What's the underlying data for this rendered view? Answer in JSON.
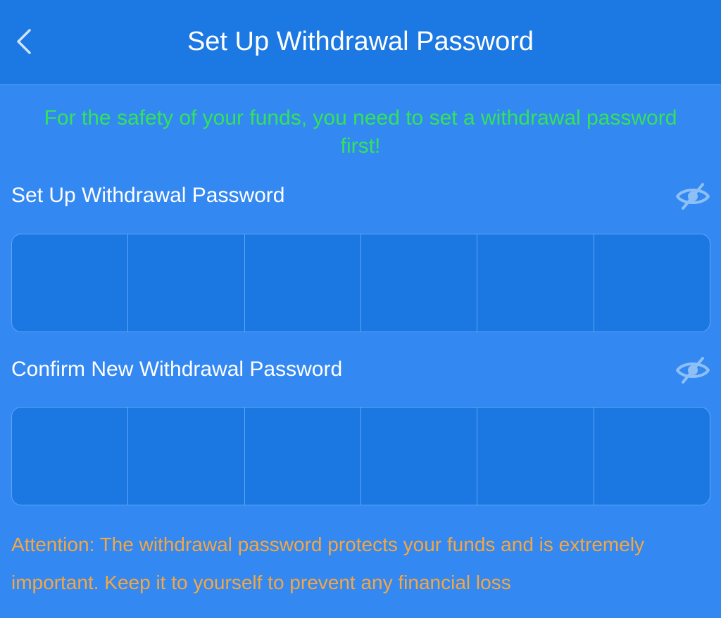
{
  "header": {
    "title": "Set Up Withdrawal Password",
    "back_icon": "chevron-left-icon"
  },
  "notice": "For the safety of your funds, you need to set a withdrawal password first!",
  "fields": [
    {
      "label": "Set Up Withdrawal Password",
      "toggle_icon": "eye-off-icon",
      "digits": [
        "",
        "",
        "",
        "",
        "",
        ""
      ]
    },
    {
      "label": "Confirm New Withdrawal Password",
      "toggle_icon": "eye-off-icon",
      "digits": [
        "",
        "",
        "",
        "",
        "",
        ""
      ]
    }
  ],
  "attention": "Attention: The withdrawal password protects your funds and is extremely important. Keep it to yourself to prevent any financial loss",
  "colors": {
    "background": "#3388f2",
    "header": "#1c78e2",
    "notice": "#33e35a",
    "attention": "#f5a741",
    "pin_box": "#1b78e2",
    "eye_icon": "#8ec0f7"
  }
}
